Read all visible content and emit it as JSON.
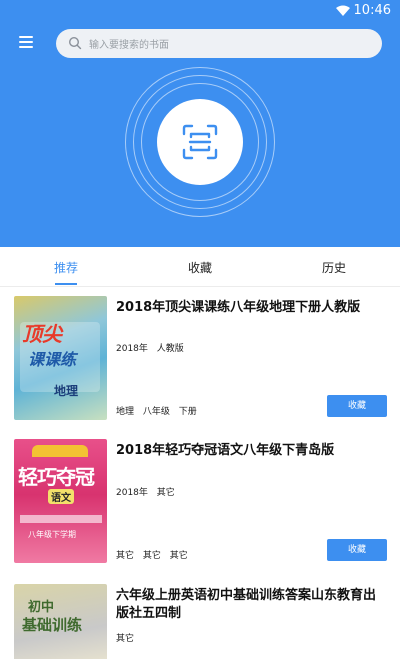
{
  "status_bar": {
    "time": "10:46"
  },
  "search": {
    "placeholder": "输入要搜索的书面"
  },
  "tabs": [
    {
      "label": "推荐",
      "active": true
    },
    {
      "label": "收藏",
      "active": false
    },
    {
      "label": "历史",
      "active": false
    }
  ],
  "books": [
    {
      "title": "2018年顶尖课课练八年级地理下册人教版",
      "meta": "2018年 人教版",
      "tags": "地理 八年级 下册",
      "collect_label": "收藏",
      "cover_text": [
        "顶尖",
        "课课练",
        "地理"
      ]
    },
    {
      "title": "2018年轻巧夺冠语文八年级下青岛版",
      "meta": "2018年 其它",
      "tags": "其它 其它 其它",
      "collect_label": "收藏",
      "cover_text": [
        "轻巧夺冠",
        "语文",
        "八年级下学期"
      ]
    },
    {
      "title": "六年级上册英语初中基础训练答案山东教育出版社五四制",
      "meta": "其它",
      "cover_text": [
        "初中",
        "基础训练"
      ]
    }
  ],
  "colors": {
    "accent": "#3d8ff0",
    "header_bg": "#3d8ff0"
  }
}
